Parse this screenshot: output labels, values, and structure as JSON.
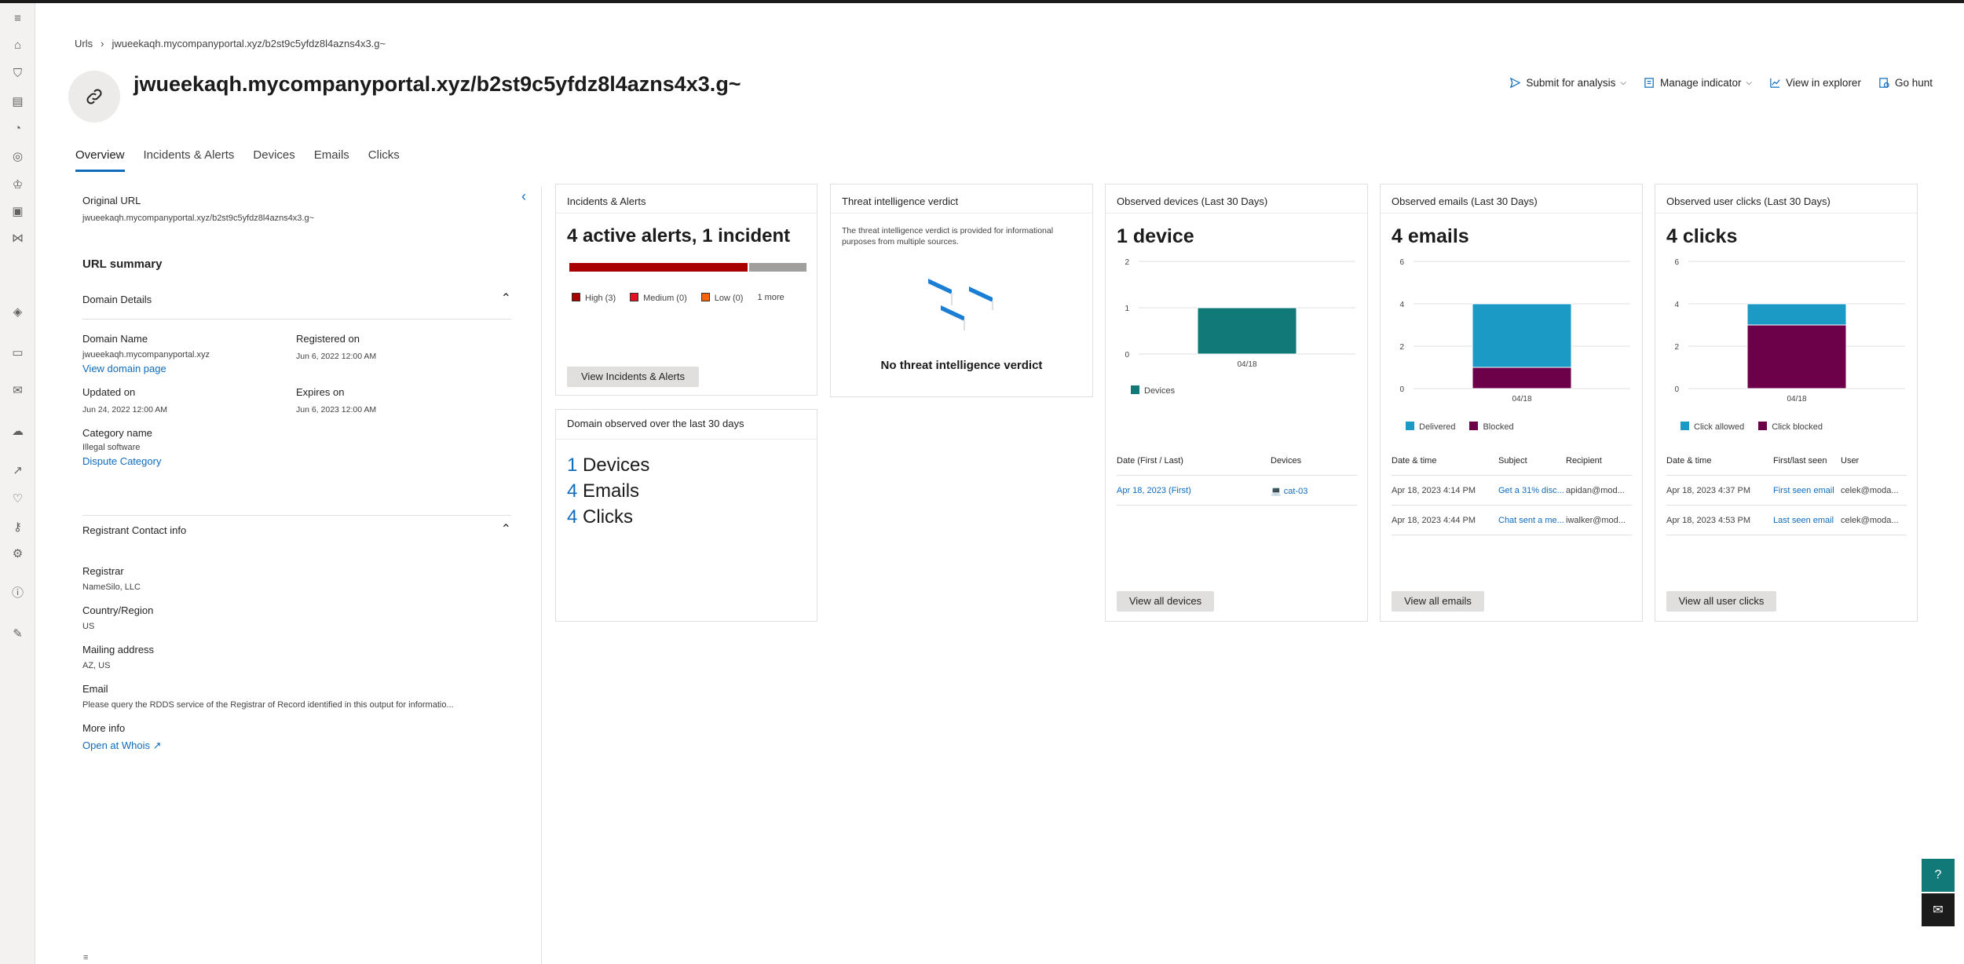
{
  "breadcrumb": {
    "root": "Urls",
    "current": "jwueekaqh.mycompanyportal.xyz/b2st9c5yfdz8l4azns4x3.g~"
  },
  "title": "jwueekaqh.mycompanyportal.xyz/b2st9c5yfdz8l4azns4x3.g~",
  "actions": {
    "submit": "Submit for analysis",
    "manage": "Manage indicator",
    "explorer": "View in explorer",
    "hunt": "Go hunt"
  },
  "tabs": [
    "Overview",
    "Incidents & Alerts",
    "Devices",
    "Emails",
    "Clicks"
  ],
  "left": {
    "original_url_label": "Original URL",
    "original_url": "jwueekaqh.mycompanyportal.xyz/b2st9c5yfdz8l4azns4x3.g~",
    "summary": "URL summary",
    "domain_details": "Domain Details",
    "domain_name_label": "Domain Name",
    "domain_name": "jwueekaqh.mycompanyportal.xyz",
    "view_domain": "View domain page",
    "registered_label": "Registered on",
    "registered": "Jun 6, 2022 12:00 AM",
    "updated_label": "Updated on",
    "updated": "Jun 24, 2022 12:00 AM",
    "expires_label": "Expires on",
    "expires": "Jun 6, 2023 12:00 AM",
    "category_label": "Category name",
    "category": "Illegal software",
    "dispute": "Dispute Category",
    "registrant": "Registrant Contact info",
    "registrar_label": "Registrar",
    "registrar": "NameSilo, LLC",
    "country_label": "Country/Region",
    "country": "US",
    "mailing_label": "Mailing address",
    "mailing": "AZ, US",
    "email_label": "Email",
    "email": "Please query the RDDS service of the Registrar of Record identified in this output for informatio...",
    "more_label": "More info",
    "whois": "Open at Whois"
  },
  "incidents": {
    "title": "Incidents & Alerts",
    "big": "4 active alerts, 1 incident",
    "high": "High (3)",
    "medium": "Medium (0)",
    "low": "Low (0)",
    "more": "1 more",
    "high_fraction": 0.75,
    "button": "View Incidents & Alerts"
  },
  "threat": {
    "title": "Threat intelligence verdict",
    "desc": "The threat intelligence verdict is provided for informational purposes from multiple sources.",
    "none": "No threat intelligence verdict"
  },
  "domain_obs": {
    "title": "Domain observed over the last 30 days",
    "devices_n": "1",
    "devices": "Devices",
    "emails_n": "4",
    "emails": "Emails",
    "clicks_n": "4",
    "clicks": "Clicks"
  },
  "devices": {
    "title": "Observed devices (Last 30 Days)",
    "big": "1 device",
    "col1": "Date (First / Last)",
    "col2": "Devices",
    "row_date": "Apr 18, 2023 (First)",
    "row_device": "cat-03",
    "button": "View all devices"
  },
  "emails": {
    "title": "Observed emails (Last 30 Days)",
    "big": "4 emails",
    "col1": "Date & time",
    "col2": "Subject",
    "col3": "Recipient",
    "rows": [
      {
        "date": "Apr 18, 2023 4:14 PM",
        "subject": "Get a 31% disc...",
        "recipient": "apidan@mod..."
      },
      {
        "date": "Apr 18, 2023 4:44 PM",
        "subject": "Chat sent a me...",
        "recipient": "iwalker@mod..."
      }
    ],
    "button": "View all emails"
  },
  "clicks": {
    "title": "Observed user clicks (Last 30 Days)",
    "big": "4 clicks",
    "col1": "Date & time",
    "col2": "First/last seen",
    "col3": "User",
    "rows": [
      {
        "date": "Apr 18, 2023 4:37 PM",
        "seen": "First seen email",
        "user": "celek@moda..."
      },
      {
        "date": "Apr 18, 2023 4:53 PM",
        "seen": "Last seen email",
        "user": "celek@moda..."
      }
    ],
    "button": "View all user clicks"
  },
  "chart_data": [
    {
      "type": "bar",
      "categories": [
        "04/18"
      ],
      "series": [
        {
          "name": "Devices",
          "values": [
            1
          ]
        }
      ],
      "ylim": [
        0,
        2
      ],
      "yticks": [
        "2",
        "1",
        "0"
      ],
      "colors": [
        "#117a78"
      ]
    },
    {
      "type": "bar",
      "stacked": true,
      "categories": [
        "04/18"
      ],
      "series": [
        {
          "name": "Delivered",
          "values": [
            3
          ]
        },
        {
          "name": "Blocked",
          "values": [
            1
          ]
        }
      ],
      "ylim": [
        0,
        6
      ],
      "yticks": [
        "6",
        "4",
        "2",
        "0"
      ],
      "colors": [
        "#1a9ac4",
        "#6c0049"
      ]
    },
    {
      "type": "bar",
      "stacked": true,
      "categories": [
        "04/18"
      ],
      "series": [
        {
          "name": "Click allowed",
          "values": [
            1
          ]
        },
        {
          "name": "Click blocked",
          "values": [
            3
          ]
        }
      ],
      "ylim": [
        0,
        6
      ],
      "yticks": [
        "6",
        "4",
        "2",
        "0"
      ],
      "colors": [
        "#1a9ac4",
        "#6c0049"
      ]
    }
  ],
  "colors": {
    "accent": "#0f6cbd",
    "high": "#a80000",
    "medium": "#e81123",
    "low": "#f7630c",
    "rest": "#a19f9d"
  }
}
